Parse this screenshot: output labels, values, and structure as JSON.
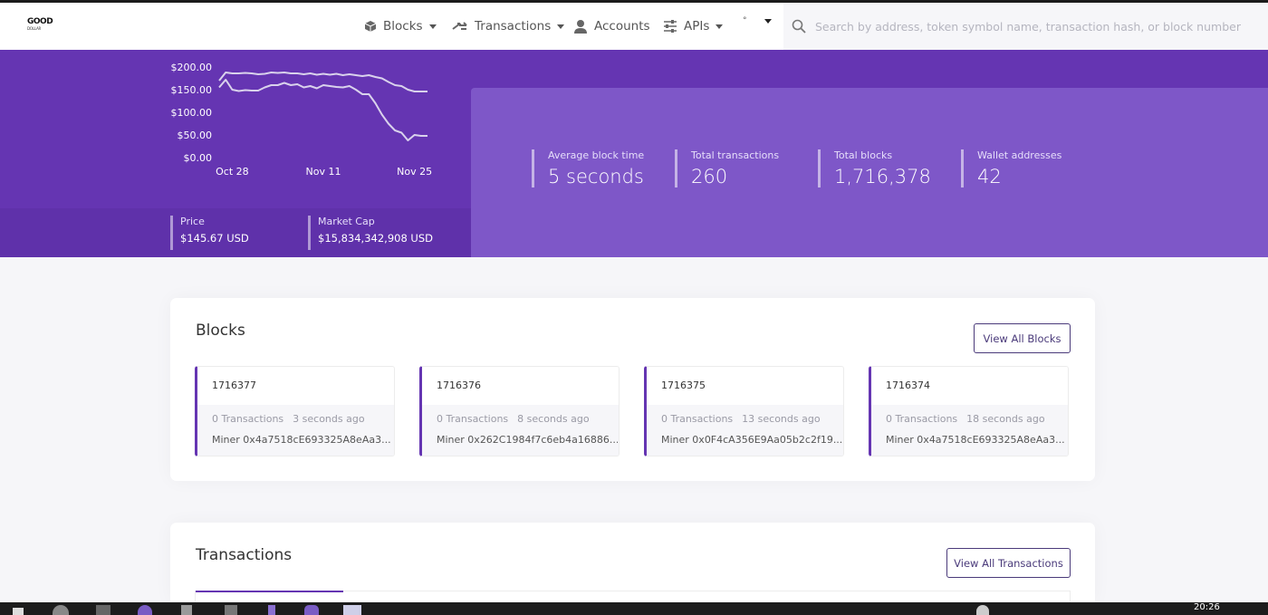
{
  "navbar": {
    "logo_text": "GOOD",
    "logo_sub": "DOLLAR",
    "items": [
      {
        "label": "Blocks",
        "icon": "cube-icon",
        "dropdown": true
      },
      {
        "label": "Transactions",
        "icon": "transfer-icon",
        "dropdown": true
      },
      {
        "label": "Accounts",
        "icon": "user-icon",
        "dropdown": false
      },
      {
        "label": "APIs",
        "icon": "sliders-icon",
        "dropdown": true
      }
    ],
    "network_dot": "°",
    "search_placeholder": "Search by address, token symbol name, transaction hash, or block number"
  },
  "price_chart": {
    "y_ticks": [
      "$200.00",
      "$150.00",
      "$100.00",
      "$50.00",
      "$0.00"
    ],
    "x_ticks": [
      "Oct 28",
      "Nov 11",
      "Nov 25"
    ]
  },
  "chart_data": {
    "type": "line",
    "title": "",
    "xlabel": "",
    "ylabel": "",
    "ylim": [
      0,
      200
    ],
    "x": [
      "Oct 26",
      "Oct 27",
      "Oct 28",
      "Oct 29",
      "Oct 30",
      "Oct 31",
      "Nov 1",
      "Nov 2",
      "Nov 3",
      "Nov 4",
      "Nov 5",
      "Nov 6",
      "Nov 7",
      "Nov 8",
      "Nov 9",
      "Nov 10",
      "Nov 11",
      "Nov 12",
      "Nov 13",
      "Nov 14",
      "Nov 15",
      "Nov 16",
      "Nov 17",
      "Nov 18",
      "Nov 19",
      "Nov 20",
      "Nov 21",
      "Nov 22",
      "Nov 23",
      "Nov 24",
      "Nov 25",
      "Nov 26",
      "Nov 27"
    ],
    "series": [
      {
        "values": [
          170,
          188,
          186,
          186,
          187,
          186,
          184,
          185,
          188,
          187,
          188,
          186,
          186,
          184,
          186,
          183,
          185,
          183,
          185,
          182,
          184,
          182,
          180,
          182,
          178,
          175,
          167,
          160,
          158,
          150,
          146,
          146,
          146
        ]
      },
      {
        "values": [
          155,
          172,
          150,
          147,
          149,
          148,
          148,
          155,
          160,
          160,
          165,
          160,
          162,
          155,
          158,
          153,
          160,
          158,
          156,
          155,
          158,
          150,
          140,
          140,
          120,
          95,
          75,
          60,
          55,
          38,
          50,
          48,
          48
        ]
      }
    ]
  },
  "price_stats": [
    {
      "label": "Price",
      "value": "$145.67 USD"
    },
    {
      "label": "Market Cap",
      "value": "$15,834,342,908 USD"
    }
  ],
  "stats": [
    {
      "label": "Average block time",
      "value": "5 seconds"
    },
    {
      "label": "Total transactions",
      "value": "260"
    },
    {
      "label": "Total blocks",
      "value": "1,716,378"
    },
    {
      "label": "Wallet addresses",
      "value": "42"
    }
  ],
  "blocks_card": {
    "title": "Blocks",
    "button": "View All Blocks",
    "items": [
      {
        "number": "1716377",
        "txs": "0 Transactions",
        "age": "3 seconds ago",
        "miner": "Miner 0x4a7518cE693325A8eAa3..."
      },
      {
        "number": "1716376",
        "txs": "0 Transactions",
        "age": "8 seconds ago",
        "miner": "Miner 0x262C1984f7c6eb4a16886..."
      },
      {
        "number": "1716375",
        "txs": "0 Transactions",
        "age": "13 seconds ago",
        "miner": "Miner 0x0F4cA356E9Aa05b2c2f19..."
      },
      {
        "number": "1716374",
        "txs": "0 Transactions",
        "age": "18 seconds ago",
        "miner": "Miner 0x4a7518cE693325A8eAa3..."
      }
    ]
  },
  "transactions_card": {
    "title": "Transactions",
    "button": "View All Transactions"
  },
  "taskbar": {
    "clock": "20:26"
  },
  "colors": {
    "brand_purple": "#6535b2",
    "stats_panel": "#7e57c8",
    "chart_line": "#d9d2ec"
  }
}
